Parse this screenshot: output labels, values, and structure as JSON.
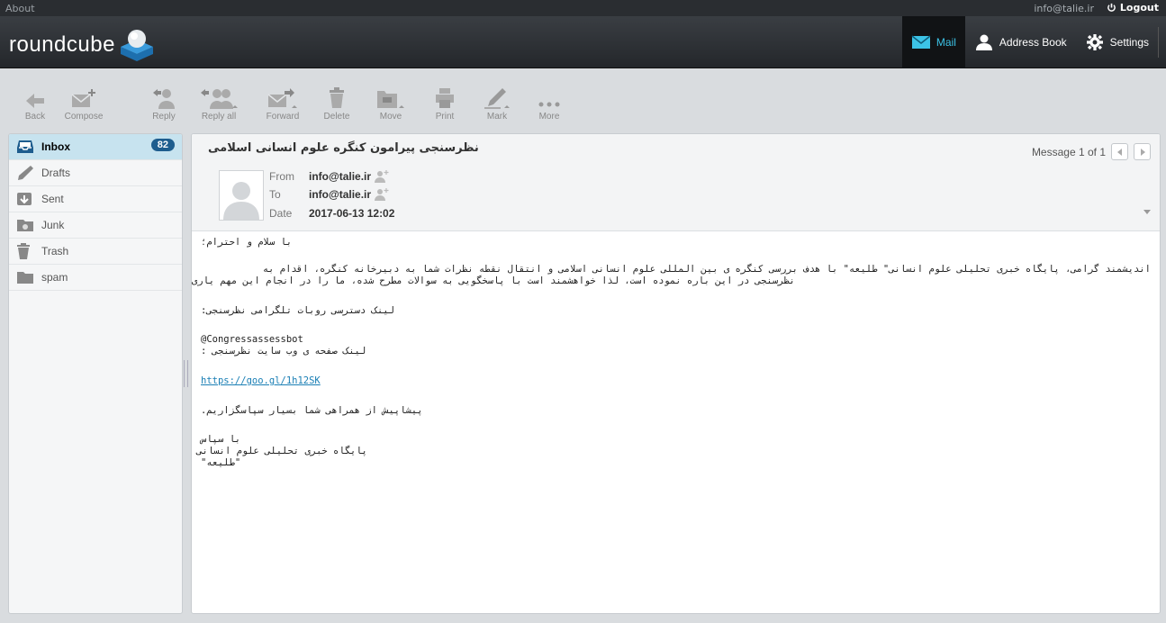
{
  "topbar": {
    "about": "About",
    "user": "info@talie.ir",
    "logout": "Logout"
  },
  "header": {
    "logo": "roundcube",
    "nav": [
      {
        "label": "Mail",
        "icon": "mail-icon",
        "active": true
      },
      {
        "label": "Address Book",
        "icon": "person-icon",
        "active": false
      },
      {
        "label": "Settings",
        "icon": "gear-icon",
        "active": false
      }
    ]
  },
  "toolbar": {
    "back": "Back",
    "compose": "Compose",
    "reply": "Reply",
    "reply_all": "Reply all",
    "forward": "Forward",
    "delete": "Delete",
    "move": "Move",
    "print": "Print",
    "mark": "Mark",
    "more": "More"
  },
  "folders": [
    {
      "label": "Inbox",
      "icon": "inbox-icon",
      "count": "82",
      "selected": true
    },
    {
      "label": "Drafts",
      "icon": "pencil-icon"
    },
    {
      "label": "Sent",
      "icon": "sent-icon"
    },
    {
      "label": "Junk",
      "icon": "junk-icon"
    },
    {
      "label": "Trash",
      "icon": "trash-icon"
    },
    {
      "label": "spam",
      "icon": "folder-icon"
    }
  ],
  "message": {
    "subject": "نظرسنجی پیرامون کنگره علوم انسانی اسلامی",
    "counter": "Message 1 of 1",
    "from_label": "From",
    "from": "info@talie.ir",
    "to_label": "To",
    "to": "info@talie.ir",
    "date_label": "Date",
    "date": "2017-06-13 12:02",
    "body": {
      "greeting": "با سلام و احترام؛",
      "para1_line1": "اندیشمند گرامی، پایگاه خبری تحلیلی علوم انسانی\" طلیعه\" با هدف بررسی کنگره ی بین المللی علوم انسانی اسلامی و انتقال نقطه نظرات شما به دبیرخانه کنگره، اقدام به",
      "para1_line2": "نظرسنجی در این باره نموده است، لذا خواهشمند است با پاسخگویی به سوالات مطرح شده، ما را در انجام این مهم یاری نمایید.",
      "bot_label": "لینک دسترسی روبات تلگرامی نظرسنجی:",
      "bot_handle": "@Congressassessbot",
      "site_label": "لینک صفحه ی وب سایت نظرسنجی :",
      "link": "https://goo.gl/1h12SK",
      "thanks": "پیشاپیش از همراهی شما بسیار سپاسگزاریم.",
      "sign1": "با سپاس",
      "sign2": "پایگاه خبری تحلیلی علوم انسانی",
      "sign3": "\"طلیعه\""
    }
  },
  "colors": {
    "accent": "#3cc3e6",
    "header": "#2a2d31",
    "selected": "#c7e3ef",
    "badge": "#1e5d8e"
  }
}
